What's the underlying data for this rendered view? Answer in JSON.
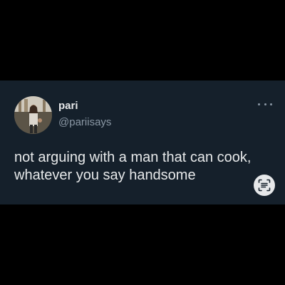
{
  "tweet": {
    "display_name": "pari",
    "handle": "@pariisays",
    "text": "not arguing with a man that can cook,\nwhatever you say handsome"
  },
  "icons": {
    "more": "more-horizontal-icon",
    "scan": "text-scan-icon"
  },
  "colors": {
    "card_background": "#15202b",
    "page_background": "#000000",
    "primary_text": "#e7e9ea",
    "secondary_text": "#8b98a5"
  }
}
